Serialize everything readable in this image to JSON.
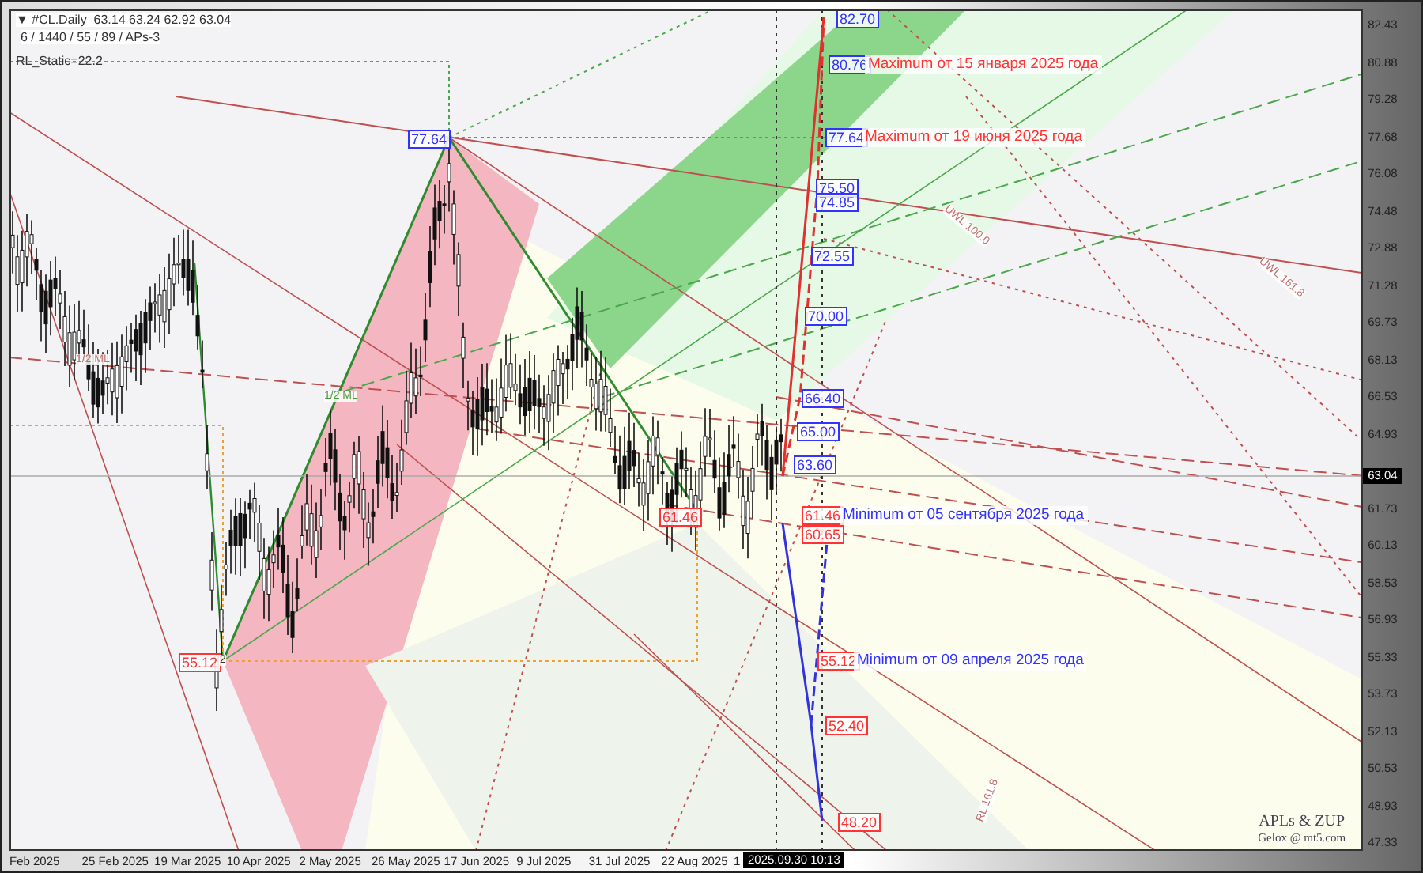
{
  "header": {
    "collapse_glyph": "▼",
    "symbol": "#CL.Daily",
    "quote": "63.14 63.24 62.92 63.04",
    "params": "6 / 1440 / 55 / 89 / APs-3",
    "static_label": "RL_Static=22.2"
  },
  "price_axis": [
    "82.43",
    "80.88",
    "79.28",
    "77.68",
    "76.08",
    "74.48",
    "72.88",
    "71.28",
    "69.73",
    "68.13",
    "66.53",
    "64.93",
    "61.73",
    "60.13",
    "58.53",
    "56.93",
    "55.33",
    "53.73",
    "52.13",
    "50.53",
    "48.93",
    "47.33"
  ],
  "current_price": "63.04",
  "date_axis": [
    "Feb 2025",
    "25 Feb 2025",
    "19 Mar 2025",
    "10 Apr 2025",
    "2 May 2025",
    "26 May 2025",
    "17 Jun 2025",
    "9 Jul 2025",
    "31 Jul 2025",
    "22 Aug 2025",
    "1"
  ],
  "cursor_time": "2025.09.30 10:13",
  "price_tags": [
    {
      "label": "77.64",
      "color": "#3333ff"
    },
    {
      "label": "55.12",
      "color": "#ff3333"
    },
    {
      "label": "61.46",
      "color": "#ff3333"
    },
    {
      "label": "82.70",
      "color": "#3333ff"
    },
    {
      "label": "80.76",
      "color": "#3333ff"
    },
    {
      "label": "77.64",
      "color": "#3333ff"
    },
    {
      "label": "75.50",
      "color": "#3333ff"
    },
    {
      "label": "74.85",
      "color": "#3333ff"
    },
    {
      "label": "72.55",
      "color": "#3333ff"
    },
    {
      "label": "70.00",
      "color": "#3333ff"
    },
    {
      "label": "66.40",
      "color": "#3333ff"
    },
    {
      "label": "65.00",
      "color": "#3333ff"
    },
    {
      "label": "63.60",
      "color": "#3333ff"
    },
    {
      "label": "61.46",
      "color": "#ff3333"
    },
    {
      "label": "60.65",
      "color": "#ff3333"
    },
    {
      "label": "55.12",
      "color": "#ff3333"
    },
    {
      "label": "52.40",
      "color": "#ff3333"
    },
    {
      "label": "48.20",
      "color": "#ff3333"
    }
  ],
  "notes": [
    {
      "text": "Maximum от 15 января 2025 года",
      "color": "#ff3333"
    },
    {
      "text": "Maximum от 19 июня 2025 года",
      "color": "#ff3333"
    },
    {
      "text": "Minimum от 05 сентября  2025 года",
      "color": "#3333ff"
    },
    {
      "text": "Minimum от 09 апреля 2025  года",
      "color": "#3333ff"
    }
  ],
  "line_labels": [
    "1/2 ML",
    "1/2 ML",
    "UWL 100.0",
    "UWL 161.8",
    "RL 161.8",
    "2"
  ],
  "signature": {
    "title": "APLs & ZUP",
    "subtitle": "Gelox @ mt5.com"
  }
}
